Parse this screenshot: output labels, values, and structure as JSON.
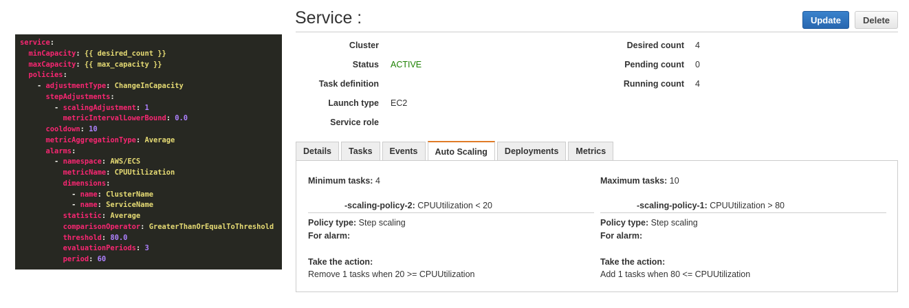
{
  "code": [
    {
      "pre": "",
      "key": "service",
      "val": "",
      "vt": ""
    },
    {
      "pre": "  ",
      "key": "minCapacity",
      "val": "{{ desired_count }}",
      "vt": "s"
    },
    {
      "pre": "  ",
      "key": "maxCapacity",
      "val": "{{ max_capacity }}",
      "vt": "s"
    },
    {
      "pre": "  ",
      "key": "policies",
      "val": "",
      "vt": ""
    },
    {
      "pre": "    - ",
      "key": "adjustmentType",
      "val": "ChangeInCapacity",
      "vt": "s"
    },
    {
      "pre": "      ",
      "key": "stepAdjustments",
      "val": "",
      "vt": ""
    },
    {
      "pre": "        - ",
      "key": "scalingAdjustment",
      "val": "1",
      "vt": "n"
    },
    {
      "pre": "          ",
      "key": "metricIntervalLowerBound",
      "val": "0.0",
      "vt": "n"
    },
    {
      "pre": "      ",
      "key": "cooldown",
      "val": "10",
      "vt": "n"
    },
    {
      "pre": "      ",
      "key": "metricAggregationType",
      "val": "Average",
      "vt": "s"
    },
    {
      "pre": "      ",
      "key": "alarms",
      "val": "",
      "vt": ""
    },
    {
      "pre": "        - ",
      "key": "namespace",
      "val": "AWS/ECS",
      "vt": "s"
    },
    {
      "pre": "          ",
      "key": "metricName",
      "val": "CPUUtilization",
      "vt": "s"
    },
    {
      "pre": "          ",
      "key": "dimensions",
      "val": "",
      "vt": ""
    },
    {
      "pre": "            - ",
      "key": "name",
      "val": "ClusterName",
      "vt": "s"
    },
    {
      "pre": "            - ",
      "key": "name",
      "val": "ServiceName",
      "vt": "s"
    },
    {
      "pre": "          ",
      "key": "statistic",
      "val": "Average",
      "vt": "s"
    },
    {
      "pre": "          ",
      "key": "comparisonOperator",
      "val": "GreaterThanOrEqualToThreshold",
      "vt": "s"
    },
    {
      "pre": "          ",
      "key": "threshold",
      "val": "80.0",
      "vt": "n"
    },
    {
      "pre": "          ",
      "key": "evaluationPeriods",
      "val": "3",
      "vt": "n"
    },
    {
      "pre": "          ",
      "key": "period",
      "val": "60",
      "vt": "n"
    }
  ],
  "header": {
    "title": "Service :",
    "update": "Update",
    "delete": "Delete"
  },
  "details_left": [
    {
      "label": "Cluster",
      "value": ""
    },
    {
      "label": "Status",
      "value": "ACTIVE"
    },
    {
      "label": "Task definition",
      "value": ""
    },
    {
      "label": "Launch type",
      "value": "EC2"
    },
    {
      "label": "Service role",
      "value": ""
    }
  ],
  "details_right": [
    {
      "label": "Desired count",
      "value": "4"
    },
    {
      "label": "Pending count",
      "value": "0"
    },
    {
      "label": "Running count",
      "value": "4"
    }
  ],
  "colors": {
    "active": "#1d8102",
    "accent": "#e07b27",
    "primary": "#2e73b8"
  },
  "tabs": [
    "Details",
    "Tasks",
    "Events",
    "Auto Scaling",
    "Deployments",
    "Metrics"
  ],
  "active_tab": "Auto Scaling",
  "autoscaling": {
    "min_label": "Minimum tasks:",
    "min": "4",
    "max_label": "Maximum tasks:",
    "max": "10",
    "policies": [
      {
        "name": "-scaling-policy-2:",
        "cond": "CPUUtilization < 20",
        "type_label": "Policy type:",
        "type": "Step scaling",
        "alarm_label": "For alarm:",
        "action_label": "Take the action:",
        "action": "Remove 1 tasks when 20 >= CPUUtilization"
      },
      {
        "name": "-scaling-policy-1:",
        "cond": "CPUUtilization > 80",
        "type_label": "Policy type:",
        "type": "Step scaling",
        "alarm_label": "For alarm:",
        "action_label": "Take the action:",
        "action": "Add 1 tasks when 80 <= CPUUtilization"
      }
    ]
  }
}
